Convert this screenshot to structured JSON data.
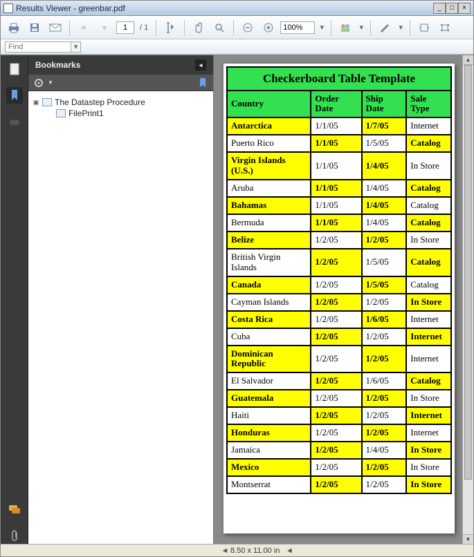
{
  "window": {
    "title": "Results Viewer - greenbar.pdf"
  },
  "toolbar": {
    "page_current": "1",
    "page_total": "/ 1",
    "zoom": "100%"
  },
  "findbar": {
    "placeholder": "Find"
  },
  "bookmarks": {
    "title": "Bookmarks",
    "tree": {
      "root": "The Datastep Procedure",
      "child": "FilePrint1"
    }
  },
  "status": {
    "page_size": "8.50 x 11.00 in"
  },
  "chart_data": {
    "type": "table",
    "title": "Checkerboard Table Template",
    "columns": [
      "Country",
      "Order Date",
      "Ship Date",
      "Sale Type"
    ],
    "rows": [
      {
        "c": "Antarctica",
        "od": "1/1/05",
        "sd": "1/7/05",
        "st": "Internet",
        "p": [
          "y",
          "w",
          "y",
          "w"
        ]
      },
      {
        "c": "Puerto Rico",
        "od": "1/1/05",
        "sd": "1/5/05",
        "st": "Catalog",
        "p": [
          "w",
          "y",
          "w",
          "y"
        ]
      },
      {
        "c": "Virgin Islands (U.S.)",
        "od": "1/1/05",
        "sd": "1/4/05",
        "st": "In Store",
        "p": [
          "y",
          "w",
          "y",
          "w"
        ]
      },
      {
        "c": "Aruba",
        "od": "1/1/05",
        "sd": "1/4/05",
        "st": "Catalog",
        "p": [
          "w",
          "y",
          "w",
          "y"
        ]
      },
      {
        "c": "Bahamas",
        "od": "1/1/05",
        "sd": "1/4/05",
        "st": "Catalog",
        "p": [
          "y",
          "w",
          "y",
          "w"
        ]
      },
      {
        "c": "Bermuda",
        "od": "1/1/05",
        "sd": "1/4/05",
        "st": "Catalog",
        "p": [
          "w",
          "y",
          "w",
          "y"
        ]
      },
      {
        "c": "Belize",
        "od": "1/2/05",
        "sd": "1/2/05",
        "st": "In Store",
        "p": [
          "y",
          "w",
          "y",
          "w"
        ]
      },
      {
        "c": "British Virgin Islands",
        "od": "1/2/05",
        "sd": "1/5/05",
        "st": "Catalog",
        "p": [
          "w",
          "y",
          "w",
          "y"
        ]
      },
      {
        "c": "Canada",
        "od": "1/2/05",
        "sd": "1/5/05",
        "st": "Catalog",
        "p": [
          "y",
          "w",
          "y",
          "w"
        ]
      },
      {
        "c": "Cayman Islands",
        "od": "1/2/05",
        "sd": "1/2/05",
        "st": "In Store",
        "p": [
          "w",
          "y",
          "w",
          "y"
        ]
      },
      {
        "c": "Costa Rica",
        "od": "1/2/05",
        "sd": "1/6/05",
        "st": "Internet",
        "p": [
          "y",
          "w",
          "y",
          "w"
        ]
      },
      {
        "c": "Cuba",
        "od": "1/2/05",
        "sd": "1/2/05",
        "st": "Internet",
        "p": [
          "w",
          "y",
          "w",
          "y"
        ]
      },
      {
        "c": "Dominican Republic",
        "od": "1/2/05",
        "sd": "1/2/05",
        "st": "Internet",
        "p": [
          "y",
          "w",
          "y",
          "w"
        ]
      },
      {
        "c": "El Salvador",
        "od": "1/2/05",
        "sd": "1/6/05",
        "st": "Catalog",
        "p": [
          "w",
          "y",
          "w",
          "y"
        ]
      },
      {
        "c": "Guatemala",
        "od": "1/2/05",
        "sd": "1/2/05",
        "st": "In Store",
        "p": [
          "y",
          "w",
          "y",
          "w"
        ]
      },
      {
        "c": "Haiti",
        "od": "1/2/05",
        "sd": "1/2/05",
        "st": "Internet",
        "p": [
          "w",
          "y",
          "w",
          "y"
        ]
      },
      {
        "c": "Honduras",
        "od": "1/2/05",
        "sd": "1/2/05",
        "st": "Internet",
        "p": [
          "y",
          "w",
          "y",
          "w"
        ]
      },
      {
        "c": "Jamaica",
        "od": "1/2/05",
        "sd": "1/4/05",
        "st": "In Store",
        "p": [
          "w",
          "y",
          "w",
          "y"
        ]
      },
      {
        "c": "Mexico",
        "od": "1/2/05",
        "sd": "1/2/05",
        "st": "In Store",
        "p": [
          "y",
          "w",
          "y",
          "w"
        ]
      },
      {
        "c": "Montserrat",
        "od": "1/2/05",
        "sd": "1/2/05",
        "st": "In Store",
        "p": [
          "w",
          "y",
          "w",
          "y"
        ]
      }
    ]
  }
}
